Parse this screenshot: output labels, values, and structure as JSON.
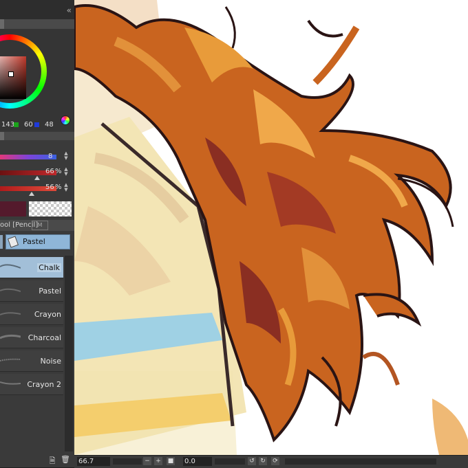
{
  "color": {
    "r": "143",
    "g": "60",
    "b": "48",
    "main_color": "#541a2c",
    "accent_red": "#c0392b"
  },
  "brush": {
    "size": "8",
    "opacity": "66",
    "opacity_unit": "%",
    "density": "56",
    "density_unit": "%",
    "opacity_level": 0.66,
    "density_level": 0.56
  },
  "subtool": {
    "header": "ool [Pencil]",
    "tab_label": "M",
    "group_button": "Pastel",
    "items": [
      {
        "name": "Chalk",
        "selected": true
      },
      {
        "name": "Pastel",
        "selected": false
      },
      {
        "name": "Crayon",
        "selected": false
      },
      {
        "name": "Charcoal",
        "selected": false
      },
      {
        "name": "Noise",
        "selected": false
      },
      {
        "name": "Crayon 2",
        "selected": false
      }
    ]
  },
  "status": {
    "zoom": "66.7",
    "rotation": "0.0"
  },
  "icons": {
    "collapse": "double-chevron-left-icon",
    "new_subtool": "new-page-icon",
    "delete": "trash-icon",
    "color_picker": "color-wheel-icon"
  }
}
